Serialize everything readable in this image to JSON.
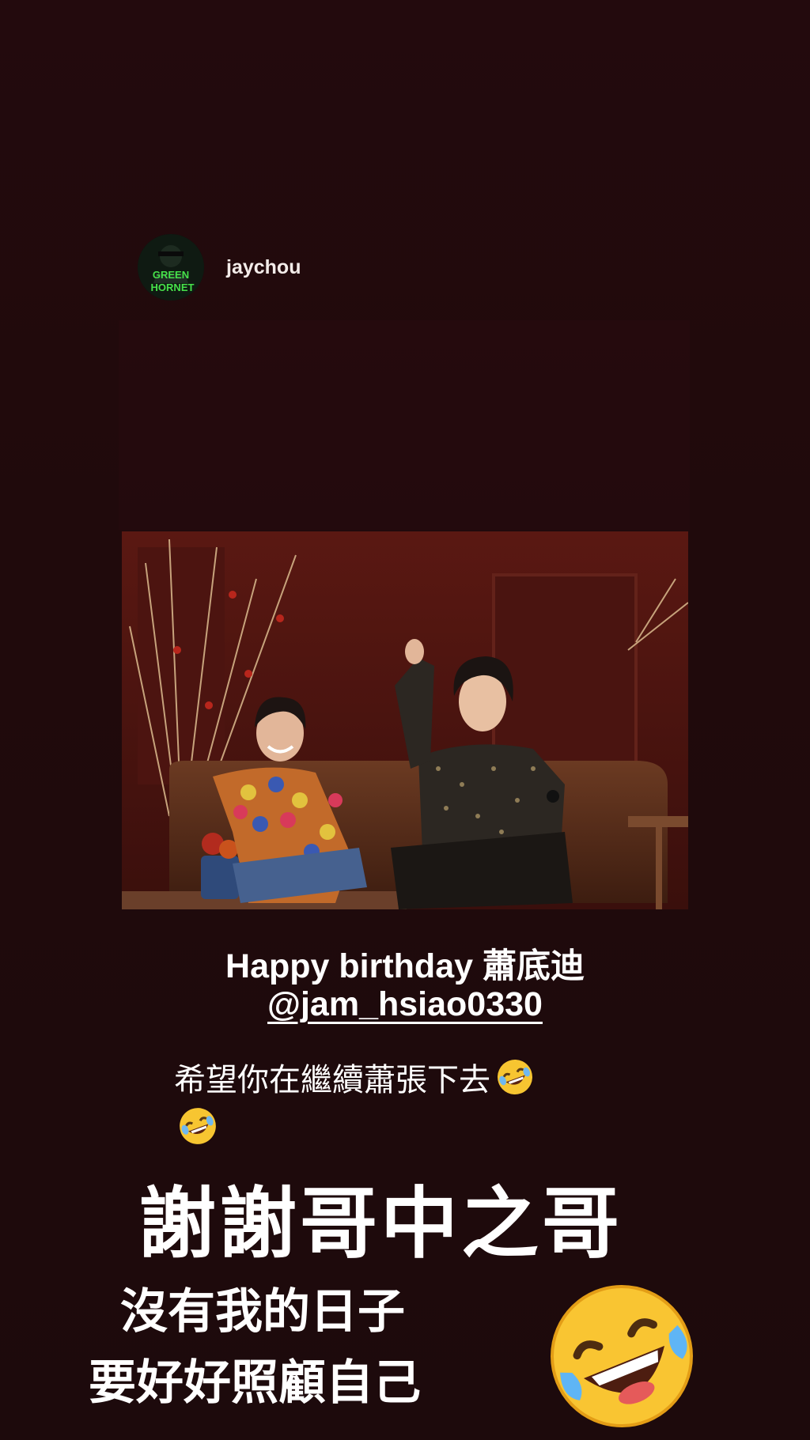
{
  "story": {
    "author": {
      "username": "jaychou",
      "avatar_icon": "green-hornet-avatar"
    },
    "photo": {
      "description_icon": "photo-two-men-on-sofa"
    },
    "caption": {
      "line1": "Happy birthday 蕭底迪",
      "mention": "@jam_hsiao0330",
      "line3": "希望你在繼續蕭張下去",
      "emoji_icon": "rolling-laughing-emoji"
    },
    "reply": {
      "headline": "謝謝哥中之哥",
      "line1": "沒有我的日子",
      "line2": "要好好照顧自己",
      "emoji_icon": "rolling-laughing-emoji"
    }
  },
  "colors": {
    "background": "#230a0d",
    "text": "#ffffff"
  }
}
